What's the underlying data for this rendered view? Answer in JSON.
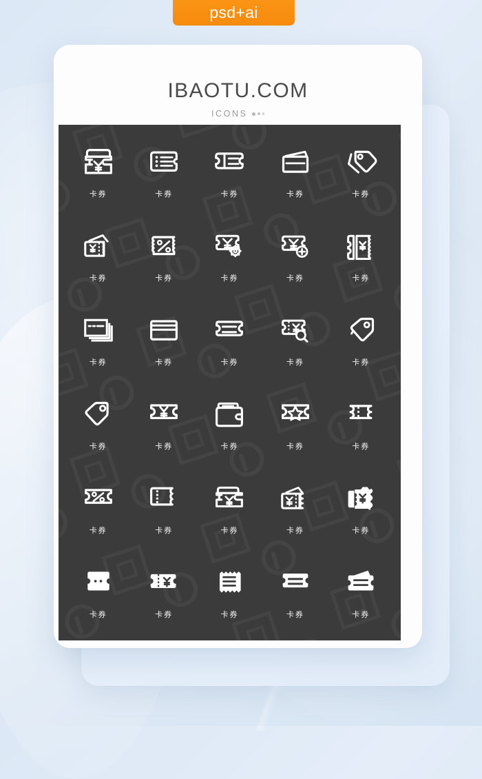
{
  "badge": {
    "label": "psd+ai",
    "color": "#f68a0c"
  },
  "card": {
    "title": "IBAOTU.COM",
    "subtitle": "ICONS",
    "panel_color": "#3b3b3b",
    "icon_color": "#ffffff"
  },
  "icons": [
    {
      "name": "ticket-yuan",
      "caption": "卡券"
    },
    {
      "name": "ticket-list",
      "caption": "卡券"
    },
    {
      "name": "ticket-split-lines",
      "caption": "卡券"
    },
    {
      "name": "card-stack-tilt",
      "caption": "卡券"
    },
    {
      "name": "tag-double",
      "caption": "卡券"
    },
    {
      "name": "ticket-stack-yuan",
      "caption": "卡券"
    },
    {
      "name": "ticket-percent",
      "caption": "卡券"
    },
    {
      "name": "ticket-yuan-settings",
      "caption": "卡券"
    },
    {
      "name": "ticket-yuan-add",
      "caption": "卡券"
    },
    {
      "name": "ticket-yuan-stub",
      "caption": "卡券"
    },
    {
      "name": "card-stack-layers",
      "caption": "卡券"
    },
    {
      "name": "credit-card-stripe",
      "caption": "卡券"
    },
    {
      "name": "ticket-two-lines",
      "caption": "卡券"
    },
    {
      "name": "ticket-yuan-search",
      "caption": "卡券"
    },
    {
      "name": "tag-single-right",
      "caption": "卡券"
    },
    {
      "name": "tag-single-left",
      "caption": "卡券"
    },
    {
      "name": "ticket-yuan-wide",
      "caption": "卡券"
    },
    {
      "name": "wallet",
      "caption": "卡券"
    },
    {
      "name": "ticket-star",
      "caption": "卡券"
    },
    {
      "name": "ticket-perforated",
      "caption": "卡券"
    },
    {
      "name": "ticket-percent-flat",
      "caption": "卡券"
    },
    {
      "name": "ticket-dotted-edge",
      "caption": "卡券"
    },
    {
      "name": "ticket-yuan-banner",
      "caption": "卡券"
    },
    {
      "name": "ticket-stack-yuan-alt",
      "caption": "卡券"
    },
    {
      "name": "ticket-yuan-filled",
      "caption": "卡券"
    },
    {
      "name": "ticket-vertical-filled",
      "caption": "卡券"
    },
    {
      "name": "ticket-yuan-stub-filled",
      "caption": "卡券"
    },
    {
      "name": "receipt-filled",
      "caption": "卡券"
    },
    {
      "name": "ticket-bar-filled",
      "caption": "卡券"
    },
    {
      "name": "ticket-stack-filled",
      "caption": "卡券"
    }
  ]
}
